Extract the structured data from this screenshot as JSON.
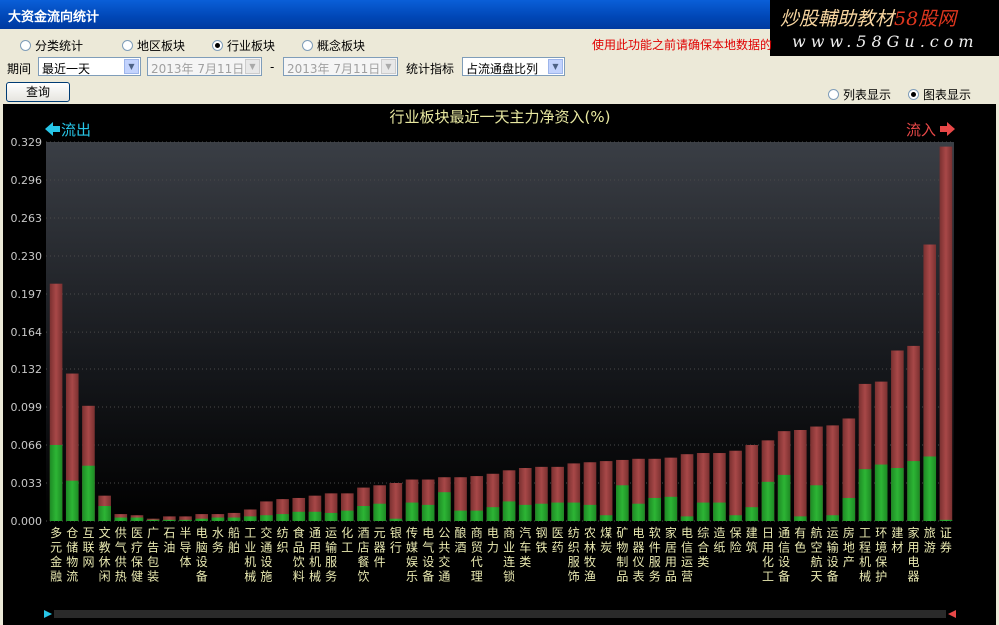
{
  "window": {
    "title": "大资金流向统计"
  },
  "brand": {
    "line1": "炒股輔助教材",
    "line1_red": "58股网",
    "line2": "www.58Gu.com"
  },
  "category_radios": [
    {
      "label": "分类统计",
      "checked": false
    },
    {
      "label": "地区板块",
      "checked": false
    },
    {
      "label": "行业板块",
      "checked": true
    },
    {
      "label": "概念板块",
      "checked": false
    }
  ],
  "warning": "使用此功能之前请确保本地数据的",
  "period": {
    "label": "期间",
    "value": "最近一天",
    "date_from": "2013年 7月11日",
    "date_sep": "-",
    "date_to": "2013年 7月11日"
  },
  "indicator": {
    "label": "统计指标",
    "value": "占流通盘比列"
  },
  "query_button": "查询",
  "display_radios": [
    {
      "label": "列表显示",
      "checked": false
    },
    {
      "label": "图表显示",
      "checked": true
    }
  ],
  "colors": {
    "green": "#2db535",
    "red": "#a84848",
    "title": "#e8e8a0",
    "axis_label": "#c8c8c8",
    "flow_out": "#27c6e8",
    "flow_in": "#e84848"
  },
  "chart_data": {
    "type": "bar",
    "title": "行业板块最近一天主力净资入(%)",
    "flow_out_label": "流出",
    "flow_in_label": "流入",
    "ylim": [
      0,
      0.329
    ],
    "yticks": [
      "0.329",
      "0.296",
      "0.263",
      "0.230",
      "0.197",
      "0.164",
      "0.132",
      "0.099",
      "0.066",
      "0.033",
      "0.000"
    ],
    "categories": [
      "多元金融",
      "仓储物流",
      "互联网",
      "文教休闲",
      "供气供热",
      "医疗保健",
      "广告包装",
      "石油",
      "半导体",
      "电脑设备",
      "水务",
      "船舶",
      "工业机械",
      "交通设施",
      "纺织",
      "食品饮料",
      "通用机械",
      "运输服务",
      "化工",
      "酒店餐饮",
      "元器件",
      "银行",
      "传媒娱乐",
      "电气设备",
      "公共交通",
      "酿酒",
      "商贸代理",
      "电力",
      "商业连锁",
      "汽车类",
      "钢铁",
      "医药",
      "纺织服饰",
      "农林牧渔",
      "煤炭",
      "矿物制品",
      "电器仪表",
      "软件服务",
      "家居用品",
      "电信运营",
      "综合类",
      "造纸",
      "保险",
      "建筑",
      "日用化工",
      "通信设备",
      "有色",
      "航空航天",
      "运输设备",
      "房地产",
      "工程机械",
      "环境保护",
      "建材",
      "家用电器",
      "旅游",
      "证券"
    ],
    "series": [
      {
        "name": "",
        "values": [
          0.206,
          0.128,
          0.1,
          0.022,
          0.006,
          0.005,
          0.002,
          0.004,
          0.004,
          0.006,
          0.006,
          0.007,
          0.01,
          0.017,
          0.019,
          0.02,
          0.022,
          0.024,
          0.024,
          0.029,
          0.031,
          0.033,
          0.036,
          0.036,
          0.038,
          0.038,
          0.039,
          0.041,
          0.044,
          0.046,
          0.047,
          0.047,
          0.05,
          0.051,
          0.052,
          0.053,
          0.054,
          0.054,
          0.055,
          0.058,
          0.059,
          0.059,
          0.061,
          0.066,
          0.07,
          0.078,
          0.079,
          0.082,
          0.083,
          0.089,
          0.119,
          0.121,
          0.148,
          0.152,
          0.24,
          0.325
        ]
      },
      {
        "name": "",
        "values": [
          0.066,
          0.035,
          0.048,
          0.013,
          0.003,
          0.003,
          0.001,
          0.001,
          0.001,
          0.002,
          0.003,
          0.003,
          0.004,
          0.005,
          0.006,
          0.008,
          0.008,
          0.007,
          0.009,
          0.013,
          0.015,
          0.002,
          0.016,
          0.014,
          0.025,
          0.009,
          0.009,
          0.012,
          0.017,
          0.014,
          0.015,
          0.016,
          0.016,
          0.014,
          0.005,
          0.031,
          0.015,
          0.02,
          0.021,
          0.004,
          0.016,
          0.016,
          0.005,
          0.012,
          0.034,
          0.04,
          0.004,
          0.031,
          0.005,
          0.02,
          0.045,
          0.049,
          0.046,
          0.052,
          0.056,
          0.001
        ]
      }
    ]
  }
}
